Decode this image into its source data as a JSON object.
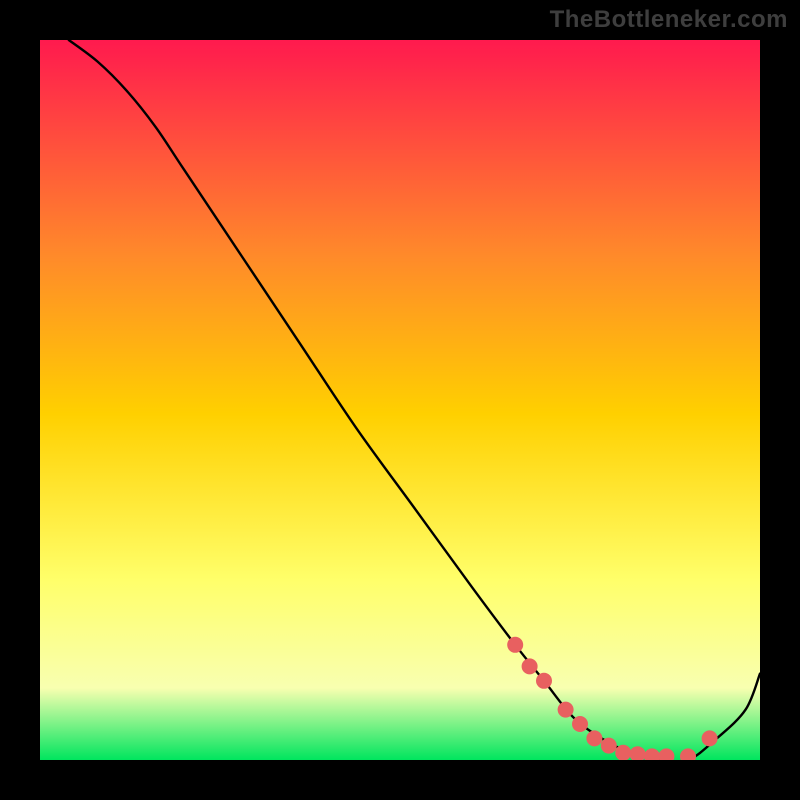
{
  "watermark": "TheBottleneker.com",
  "chart_data": {
    "type": "line",
    "title": "",
    "xlabel": "",
    "ylabel": "",
    "xlim": [
      0,
      100
    ],
    "ylim": [
      0,
      100
    ],
    "grid": false,
    "background_gradient": {
      "top": "#ff1a4e",
      "mid_upper": "#ff8a2a",
      "mid": "#ffd000",
      "mid_lower": "#ffff6a",
      "lower": "#f8ffb0",
      "bottom": "#00e55e"
    },
    "series": [
      {
        "name": "curve",
        "x": [
          4,
          8,
          12,
          16,
          20,
          28,
          36,
          44,
          52,
          60,
          66,
          70,
          74,
          78,
          82,
          86,
          90,
          94,
          98,
          100
        ],
        "y": [
          100,
          97,
          93,
          88,
          82,
          70,
          58,
          46,
          35,
          24,
          16,
          11,
          6,
          3,
          1,
          0,
          0,
          3,
          7,
          12
        ]
      }
    ],
    "markers": {
      "name": "highlight",
      "color": "#e86060",
      "x": [
        66,
        68,
        70,
        73,
        75,
        77,
        79,
        81,
        83,
        85,
        87,
        90,
        93
      ],
      "y": [
        16,
        13,
        11,
        7,
        5,
        3,
        2,
        1,
        0.8,
        0.5,
        0.5,
        0.5,
        3
      ]
    }
  }
}
